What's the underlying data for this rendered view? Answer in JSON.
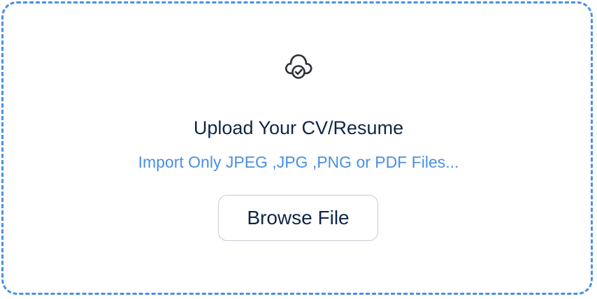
{
  "upload": {
    "icon": "cloud-check-icon",
    "title": "Upload Your CV/Resume",
    "subtitle": "Import Only JPEG ,JPG ,PNG or PDF Files...",
    "button_label": "Browse File"
  },
  "colors": {
    "accent": "#4a90e2",
    "heading": "#0f2745",
    "button_border": "#c8ccd2"
  }
}
